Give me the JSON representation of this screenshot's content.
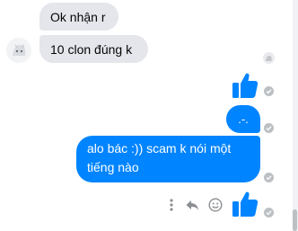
{
  "conversation": {
    "incoming": [
      {
        "text": "Ok nhận r"
      },
      {
        "text": "10 clon đúng k"
      }
    ],
    "outgoing": [
      {
        "text": ".-."
      },
      {
        "text": "alo bác :)) scam k nói một tiếng nào"
      }
    ]
  },
  "icons": {
    "like": "thumbs-up-icon",
    "seen": "check-icon",
    "more": "more-vertical-icon",
    "reply": "reply-icon",
    "react": "smiley-icon"
  },
  "colors": {
    "outgoing_bubble": "#0084ff",
    "incoming_bubble": "#e4e6eb",
    "seen_circle": "#bcc0c4"
  }
}
